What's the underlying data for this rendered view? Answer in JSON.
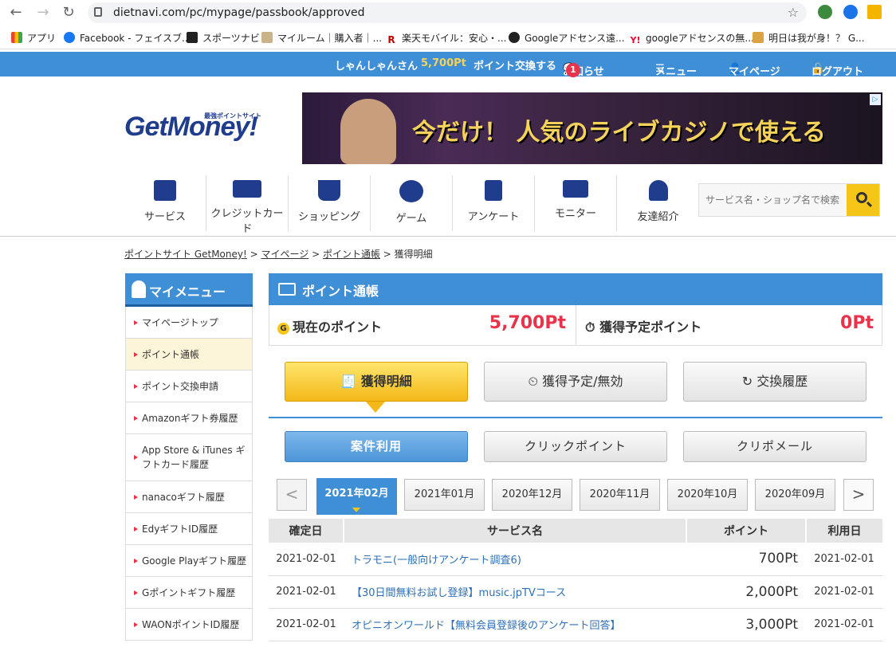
{
  "browser": {
    "url": "dietnavi.com/pc/mypage/passbook/approved",
    "bookmarks": [
      "アプリ",
      "Facebook - フェイスブ...",
      "スポーツナビ",
      "マイルーム｜購入者｜...",
      "楽天モバイル：安心・...",
      "Googleアドセンス遠...",
      "googleアドセンスの無...",
      "明日は我が身！？ G..."
    ]
  },
  "topbar": {
    "username": "しゃんしゃんさん",
    "points": "5,700Pt",
    "exchange": "ポイント交換する",
    "notice": "お知らせ",
    "notice_count": "1",
    "menu": "メニュー",
    "mypage": "マイページ",
    "logout": "ログアウト"
  },
  "logo": {
    "text": "GetMoney!",
    "sub": "最強ポイントサイト"
  },
  "banner": {
    "text": "今だけ！ 人気のライブカジノで使える"
  },
  "categories": [
    "サービス",
    "クレジットカード",
    "ショッピング",
    "ゲーム",
    "アンケート",
    "モニター",
    "友達紹介"
  ],
  "search": {
    "placeholder": "サービス名・ショップ名で検索"
  },
  "breadcrumb": [
    "ポイントサイト GetMoney!",
    "マイページ",
    "ポイント通帳",
    "獲得明細"
  ],
  "sidebar": {
    "title": "マイメニュー",
    "items": [
      "マイページトップ",
      "ポイント通帳",
      "ポイント交換申請",
      "Amazonギフト券履歴",
      "App Store & iTunes ギフトカード履歴",
      "nanacoギフト履歴",
      "EdyギフトID履歴",
      "Google Playギフト履歴",
      "Gポイントギフト履歴",
      "WAONポイントID履歴"
    ]
  },
  "passbook": {
    "title": "ポイント通帳",
    "current_label": "現在のポイント",
    "current_value": "5,700Pt",
    "pending_label": "獲得予定ポイント",
    "pending_value": "0Pt"
  },
  "tabs": [
    "獲得明細",
    "獲得予定/無効",
    "交換履歴"
  ],
  "subtabs": [
    "案件利用",
    "クリックポイント",
    "クリポメール"
  ],
  "months": [
    "2021年02月",
    "2021年01月",
    "2020年12月",
    "2020年11月",
    "2020年10月",
    "2020年09月"
  ],
  "pager": {
    "prev": "<",
    "next": ">"
  },
  "table": {
    "headers": [
      "確定日",
      "サービス名",
      "ポイント",
      "利用日"
    ],
    "rows": [
      {
        "date": "2021-02-01",
        "service": "トラモニ(一般向けアンケート調査6)",
        "points": "700Pt",
        "used": "2021-02-01"
      },
      {
        "date": "2021-02-01",
        "service": "【30日間無料お試し登録】music.jpTVコース",
        "points": "2,000Pt",
        "used": "2021-02-01"
      },
      {
        "date": "2021-02-01",
        "service": "オピニオンワールド【無料会員登録後のアンケート回答】",
        "points": "3,000Pt",
        "used": "2021-02-01"
      }
    ]
  },
  "colors": {
    "brand": "#3f8fd6",
    "accent": "#f4b818",
    "points_red": "#e8334a"
  }
}
